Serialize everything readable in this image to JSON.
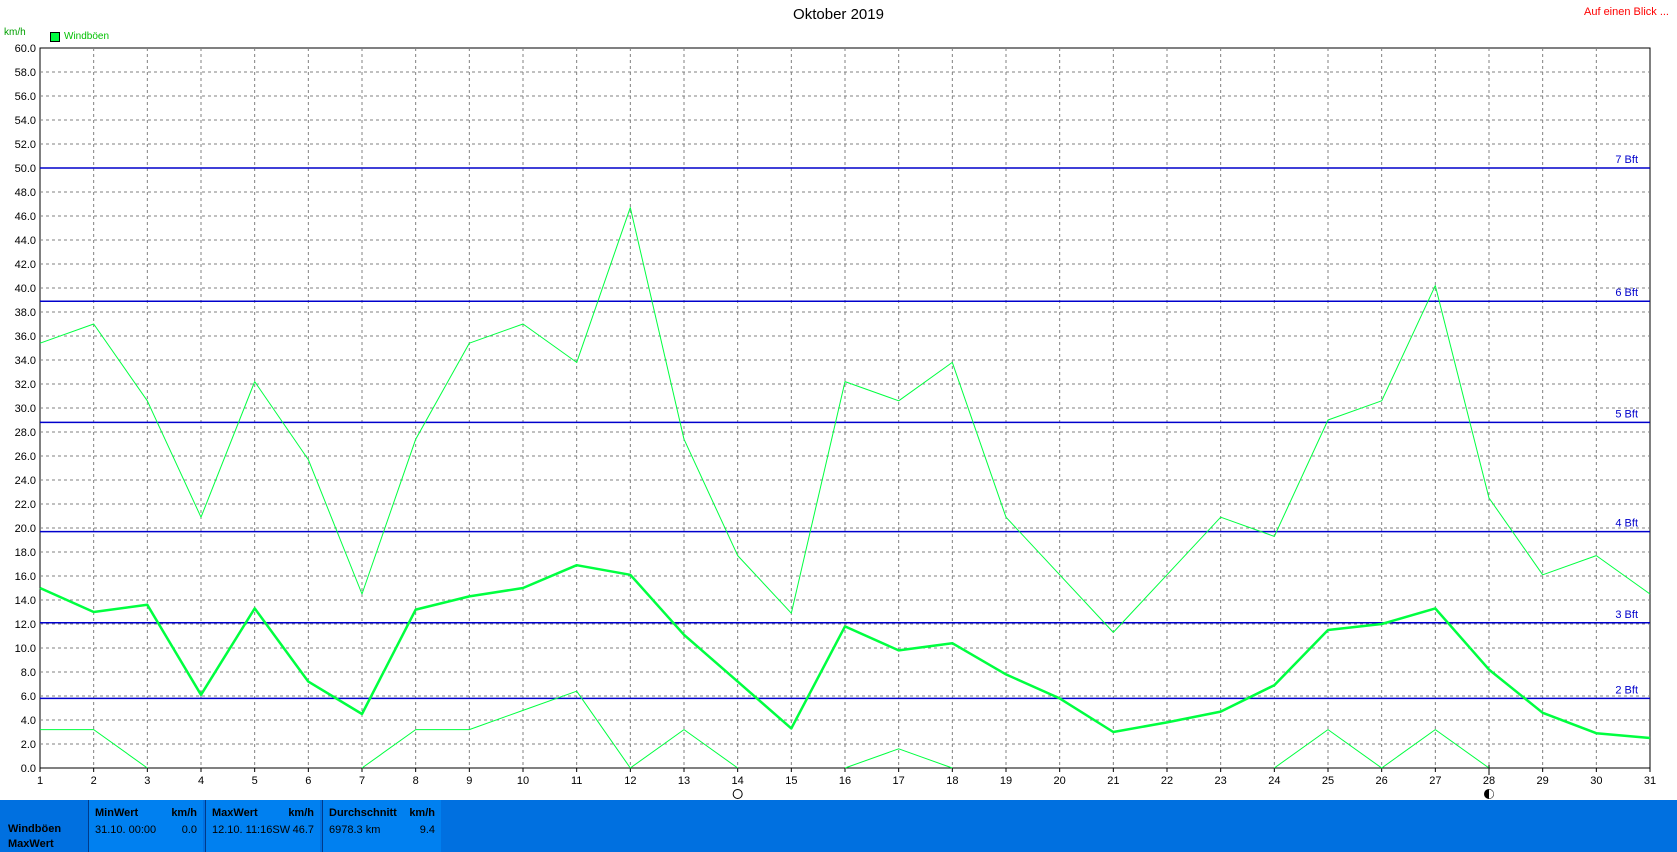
{
  "page": {
    "title": "Oktober 2019",
    "link": "Auf einen Blick ...",
    "unit": "km/h",
    "legend": "Windböen"
  },
  "colors": {
    "series": "#00ff40",
    "beaufort": "#0000cc",
    "grid": "#808080",
    "footer_bg": "#0070e0",
    "link": "#ff0000"
  },
  "chart_data": {
    "type": "line",
    "title": "Oktober 2019",
    "ylabel": "km/h",
    "xlabel": "",
    "ylim": [
      0,
      60
    ],
    "y_ticks": [
      "0.0",
      "2.0",
      "4.0",
      "6.0",
      "8.0",
      "10.0",
      "12.0",
      "14.0",
      "16.0",
      "18.0",
      "20.0",
      "22.0",
      "24.0",
      "26.0",
      "28.0",
      "30.0",
      "32.0",
      "34.0",
      "36.0",
      "38.0",
      "40.0",
      "42.0",
      "44.0",
      "46.0",
      "48.0",
      "50.0",
      "52.0",
      "54.0",
      "56.0",
      "58.0",
      "60.0"
    ],
    "x": [
      1,
      2,
      3,
      4,
      5,
      6,
      7,
      8,
      9,
      10,
      11,
      12,
      13,
      14,
      15,
      16,
      17,
      18,
      19,
      20,
      21,
      22,
      23,
      24,
      25,
      26,
      27,
      28,
      29,
      30,
      31
    ],
    "series": [
      {
        "name": "Windböen",
        "role": "max",
        "values": [
          35.4,
          37.0,
          30.6,
          20.9,
          32.2,
          25.7,
          14.5,
          27.4,
          35.4,
          37.0,
          33.8,
          46.7,
          27.4,
          17.7,
          12.9,
          32.2,
          30.6,
          33.8,
          20.9,
          16.1,
          11.3,
          16.1,
          20.9,
          19.3,
          29.0,
          30.6,
          40.2,
          22.5,
          16.1,
          17.7,
          14.5
        ]
      },
      {
        "name": "Windböen",
        "role": "avg",
        "values": [
          15.0,
          13.0,
          13.6,
          6.1,
          13.3,
          7.2,
          4.5,
          13.2,
          14.3,
          15.0,
          16.9,
          16.1,
          11.1,
          7.2,
          3.3,
          11.8,
          9.8,
          10.4,
          7.8,
          5.8,
          3.0,
          3.8,
          4.7,
          6.9,
          11.5,
          12.0,
          13.3,
          8.2,
          4.6,
          2.9,
          2.5
        ]
      },
      {
        "name": "Windböen",
        "role": "min",
        "values": [
          3.2,
          3.2,
          0.0,
          null,
          null,
          null,
          0.0,
          3.2,
          3.2,
          4.8,
          6.4,
          0.0,
          3.2,
          0.0,
          null,
          0.0,
          1.6,
          0.0,
          null,
          null,
          null,
          null,
          null,
          0.0,
          3.2,
          0.0,
          3.2,
          0.0,
          null,
          null,
          null
        ]
      }
    ],
    "reference_lines": [
      {
        "label": "2 Bft",
        "value": 5.8
      },
      {
        "label": "3 Bft",
        "value": 12.1
      },
      {
        "label": "4 Bft",
        "value": 19.7
      },
      {
        "label": "5 Bft",
        "value": 28.8
      },
      {
        "label": "6 Bft",
        "value": 38.9
      },
      {
        "label": "7 Bft",
        "value": 50.0
      }
    ],
    "moon_phases": [
      {
        "day": 14,
        "phase": "full"
      },
      {
        "day": 28,
        "phase": "new"
      }
    ],
    "grid": true,
    "legend_position": "top-left"
  },
  "footer": {
    "row_labels": [
      "Windböen",
      "MaxWert"
    ],
    "minwert": {
      "header": "MinWert",
      "unit": "km/h",
      "date": "31.10.  00:00",
      "value": "0.0"
    },
    "maxwert": {
      "header": "MaxWert",
      "unit": "km/h",
      "date": "12.10.  11:16",
      "dir": "SW",
      "value": "46.7"
    },
    "durchschnitt": {
      "header": "Durchschnitt",
      "unit": "km/h",
      "distance": "6978.3 km",
      "value": "9.4"
    }
  }
}
